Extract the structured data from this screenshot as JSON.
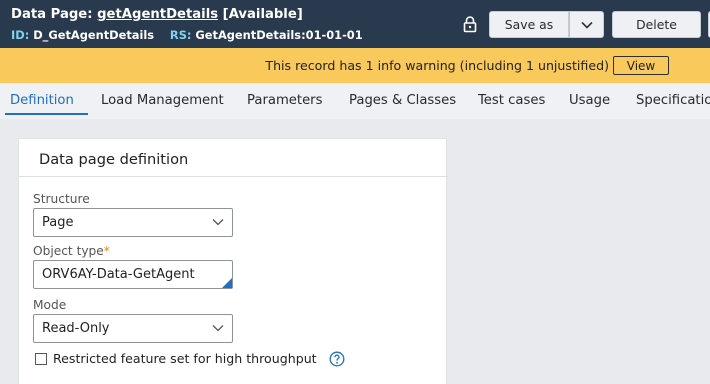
{
  "header": {
    "title_prefix": "Data Page: ",
    "page_name": "getAgentDetails",
    "status": " [Available]",
    "id_label": "ID:",
    "id_value": "D_GetAgentDetails",
    "rs_label": "RS:",
    "rs_value": "GetAgentDetails:01-01-01",
    "save_as_label": "Save as",
    "delete_label": "Delete"
  },
  "banner": {
    "message": "This record has 1 info warning (including 1 unjustified)",
    "view_label": "View"
  },
  "tabs": [
    {
      "label": "Definition",
      "active": true
    },
    {
      "label": "Load Management"
    },
    {
      "label": "Parameters"
    },
    {
      "label": "Pages & Classes"
    },
    {
      "label": "Test cases"
    },
    {
      "label": "Usage"
    },
    {
      "label": "Specificatio"
    }
  ],
  "card": {
    "title": "Data page definition",
    "structure": {
      "label": "Structure",
      "value": "Page"
    },
    "object_type": {
      "label": "Object type",
      "required_mark": "*",
      "value": "ORV6AY-Data-GetAgent"
    },
    "mode": {
      "label": "Mode",
      "value": "Read-Only"
    },
    "restricted": {
      "label": "Restricted feature set for high throughput",
      "checked": false
    }
  },
  "colors": {
    "header_bg": "#2a3a4e",
    "banner_bg": "#f9c95b",
    "accent": "#1f6fc2",
    "required": "#e38a00"
  }
}
